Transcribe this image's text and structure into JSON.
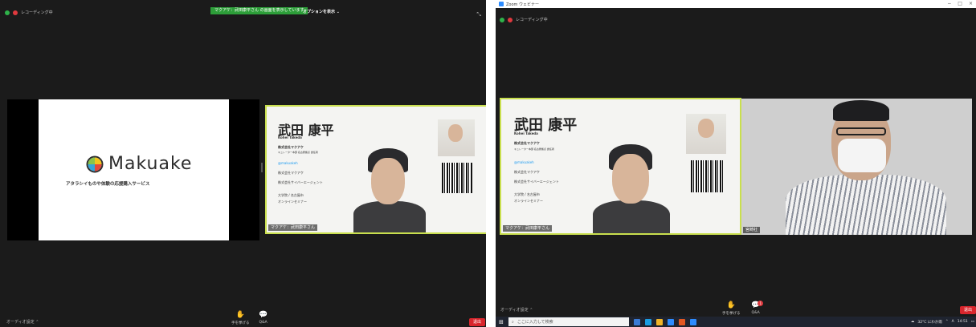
{
  "left": {
    "recording_label": "レコーディング中",
    "banner": "マクアケ：武田康平さん の画面を表示しています",
    "view_options": "オプションを表示 ⌄",
    "slide_brand": "Makuake",
    "slide_tagline": "アタラシイものや体験の応援購入サービス",
    "video_name_tag": "マクアケ：武田康平さん",
    "audio_settings": "オーディオ設定 ⌃",
    "controls": [
      {
        "icon": "raise-hand-icon",
        "label": "手を挙げる"
      },
      {
        "icon": "qa-icon",
        "label": "Q&A"
      }
    ],
    "exit_label": "退出"
  },
  "right": {
    "window_title": "Zoom ウェビナー",
    "window_controls": [
      "−",
      "□",
      "×"
    ],
    "recording_label": "レコーディング中",
    "video1_name_tag": "マクアケ：武田康平さん",
    "video2_name_tag": "宮崎社",
    "audio_settings": "オーディオ設定 ⌃",
    "controls": [
      {
        "icon": "raise-hand-icon",
        "label": "手を挙げる"
      },
      {
        "icon": "qa-icon",
        "label": "Q&A",
        "badge": "1"
      }
    ],
    "exit_label": "退出",
    "taskbar": {
      "search_placeholder": "ここに入力して検索",
      "weather": "32°C にわか雨",
      "ime": "A",
      "time": "14:51"
    }
  },
  "card": {
    "name": "武田 康平",
    "name_roman": "Kohei Takeda",
    "company": "株式会社マクアケ",
    "role": "キュレーター本部 名古屋拠点 責任者",
    "handle": "@makuakeh",
    "line1": "株式会社マクアケ",
    "line2": "株式会社サイバーエージェント",
    "line3": "大学院 / 名古屋市",
    "line4": "オンラインセミナー"
  },
  "colors": {
    "accent_green": "#2d9e39",
    "active_speaker_border": "#c9df4e",
    "exit_red": "#d9262d"
  }
}
